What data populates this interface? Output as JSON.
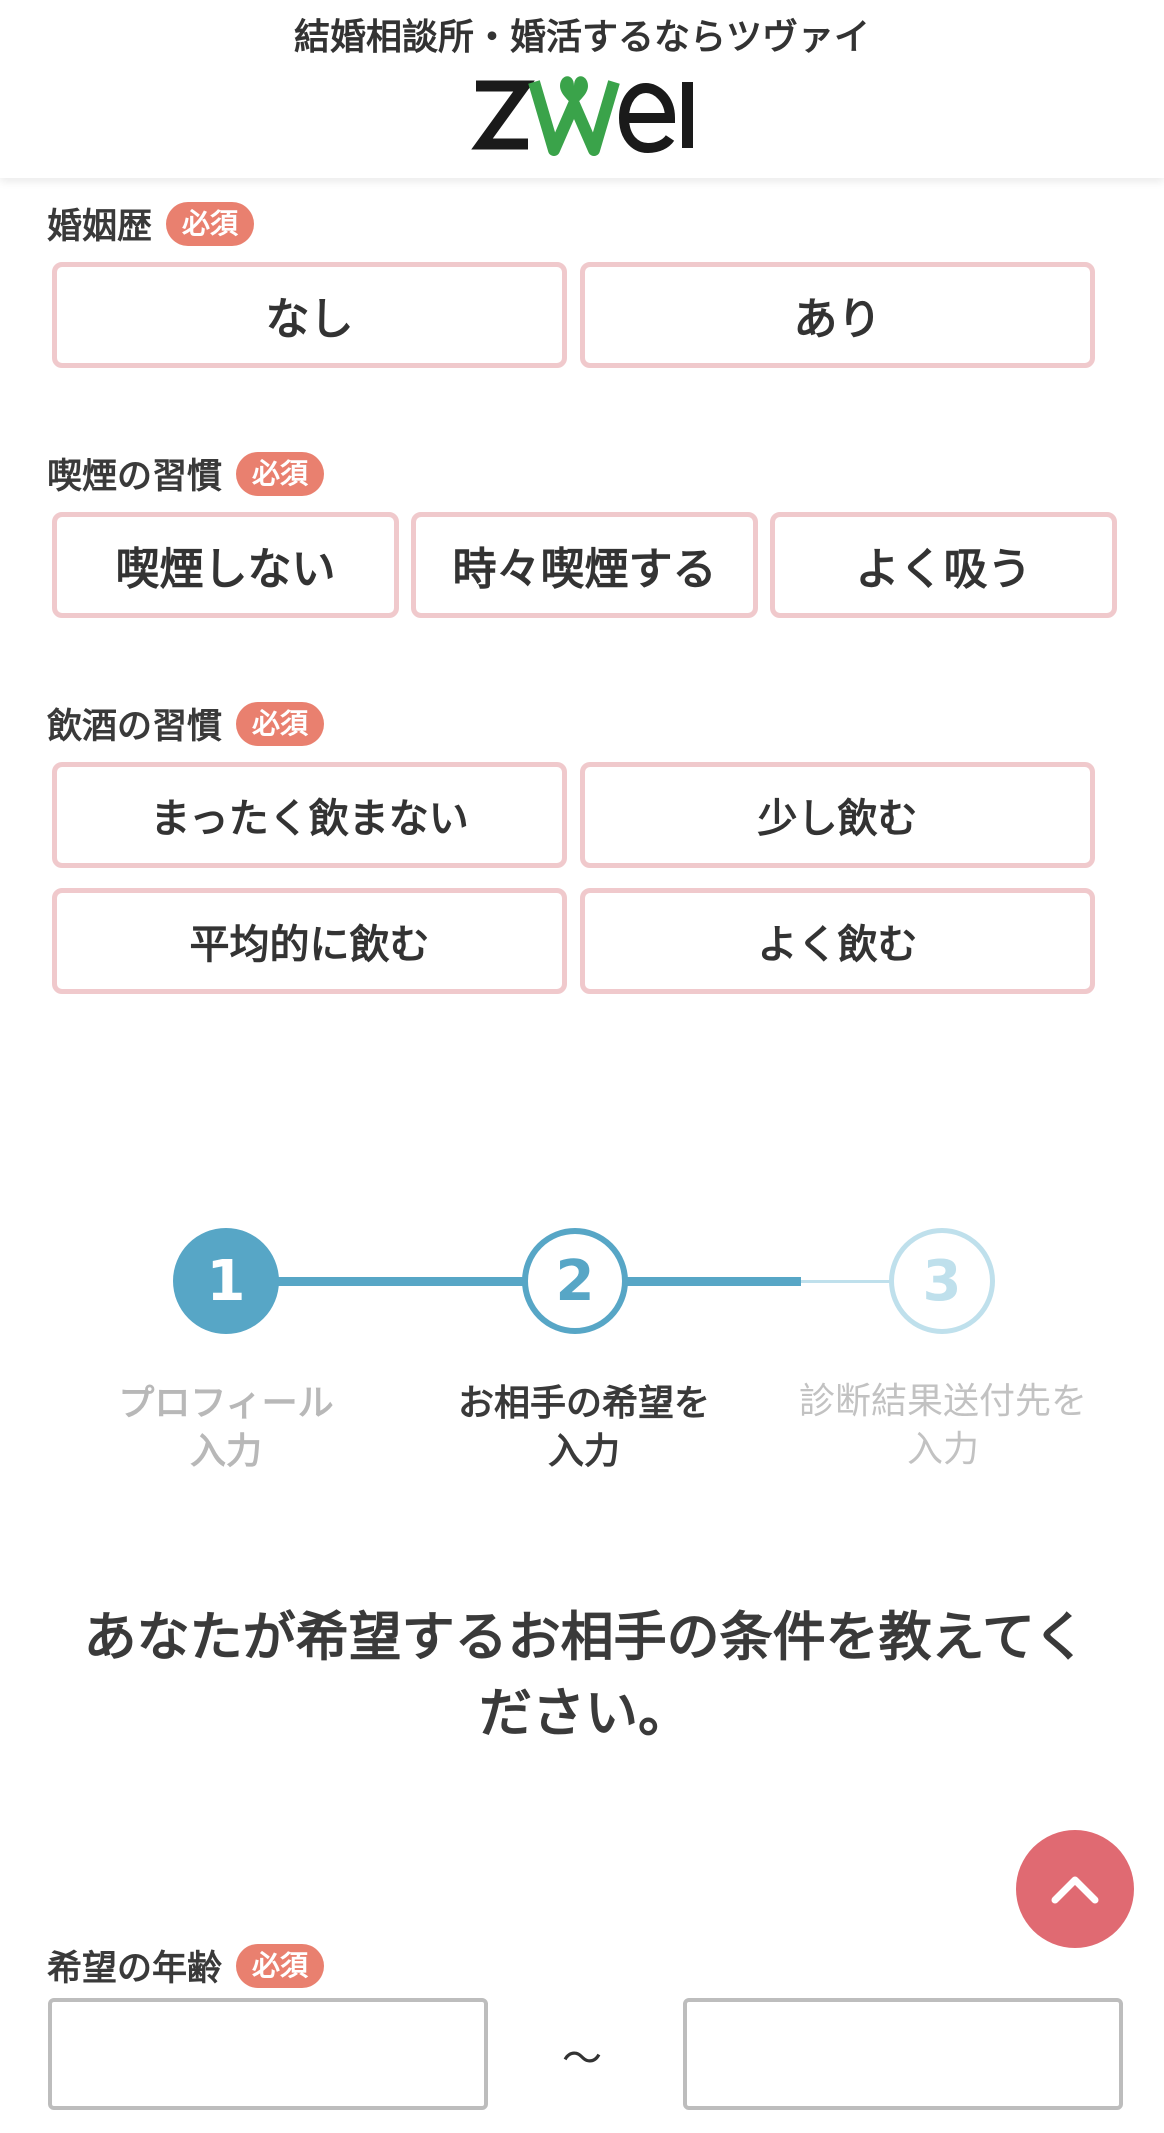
{
  "header": {
    "tagline": "結婚相談所・婚活するならツヴァイ",
    "logo_text": "zwei"
  },
  "marital_history": {
    "label": "婚姻歴",
    "badge": "必須",
    "options": [
      "なし",
      "あり"
    ]
  },
  "smoking": {
    "label": "喫煙の習慣",
    "badge": "必須",
    "options": [
      "喫煙しない",
      "時々喫煙する",
      "よく吸う"
    ]
  },
  "drinking": {
    "label": "飲酒の習慣",
    "badge": "必須",
    "options": [
      "まったく飲まない",
      "少し飲む",
      "平均的に飲む",
      "よく飲む"
    ]
  },
  "steps": [
    {
      "number": "1",
      "line1": "プロフィール",
      "line2": "入力",
      "state": "done"
    },
    {
      "number": "2",
      "line1": "お相手の希望を",
      "line2": "入力",
      "state": "current"
    },
    {
      "number": "3",
      "line1": "診断結果送付先を",
      "line2": "入力",
      "state": "todo"
    }
  ],
  "headline": {
    "line1": "あなたが希望するお相手の条件を教えてく",
    "line2": "ださい。"
  },
  "age": {
    "label": "希望の年齢",
    "badge": "必須",
    "min_value": "",
    "max_value": "",
    "separator": "〜"
  },
  "colors": {
    "accent_blue": "#57a6c6",
    "badge": "#e9806f",
    "option_border": "#f0c9cc",
    "to_top_button": "#e06a72",
    "logo_green": "#3aa34a"
  },
  "icons": {
    "to_top": "chevron-up-icon",
    "logo_heart": "heart-icon"
  }
}
